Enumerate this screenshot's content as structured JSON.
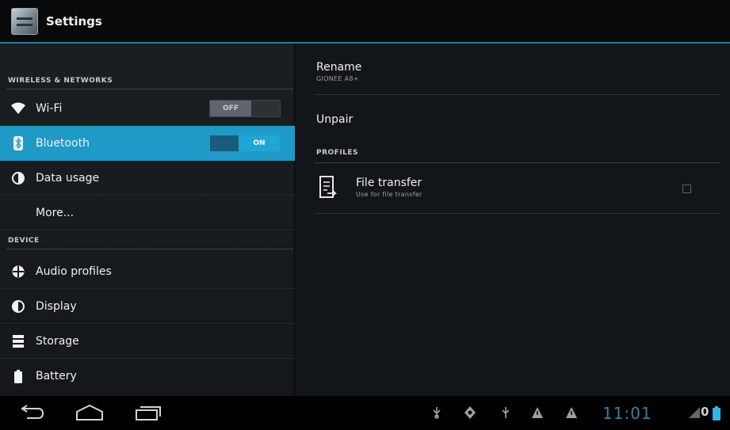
{
  "app": {
    "title": "Settings",
    "app_icon": "settings-icon"
  },
  "left": {
    "sections": [
      {
        "title": "WIRELESS & NETWORKS"
      },
      {
        "title": "DEVICE"
      }
    ],
    "items": [
      {
        "label": "Wi-Fi",
        "icon": "wifi-icon",
        "toggle": "OFF",
        "selected": false
      },
      {
        "label": "Bluetooth",
        "icon": "bluetooth-icon",
        "toggle": "ON",
        "selected": true
      },
      {
        "label": "Data usage",
        "icon": "data-usage-icon"
      },
      {
        "label": "More..."
      },
      {
        "label": "Audio profiles",
        "icon": "audio-profiles-icon"
      },
      {
        "label": "Display",
        "icon": "display-icon"
      },
      {
        "label": "Storage",
        "icon": "storage-icon"
      },
      {
        "label": "Battery",
        "icon": "battery-icon"
      }
    ]
  },
  "right": {
    "rename": {
      "title": "Rename",
      "subtitle": "GIONEE A8+"
    },
    "unpair": {
      "title": "Unpair"
    },
    "profiles_header": "PROFILES",
    "file_transfer": {
      "title": "File transfer",
      "subtitle": "Use for file transfer",
      "icon": "file-transfer-icon",
      "checked": false
    }
  },
  "navbar": {
    "buttons": [
      "back-icon",
      "home-icon",
      "recent-apps-icon"
    ],
    "status_icons": [
      "usb-icon",
      "usb-debug-icon",
      "usb-icon",
      "warning-icon",
      "warning-icon",
      "signal-icon",
      "battery-icon"
    ],
    "clock": "11:01",
    "battery_label": "0"
  },
  "colors": {
    "accent": "#1f9ac7",
    "actionbar_line": "#1f7fa6",
    "clock": "#3c7ea0"
  }
}
